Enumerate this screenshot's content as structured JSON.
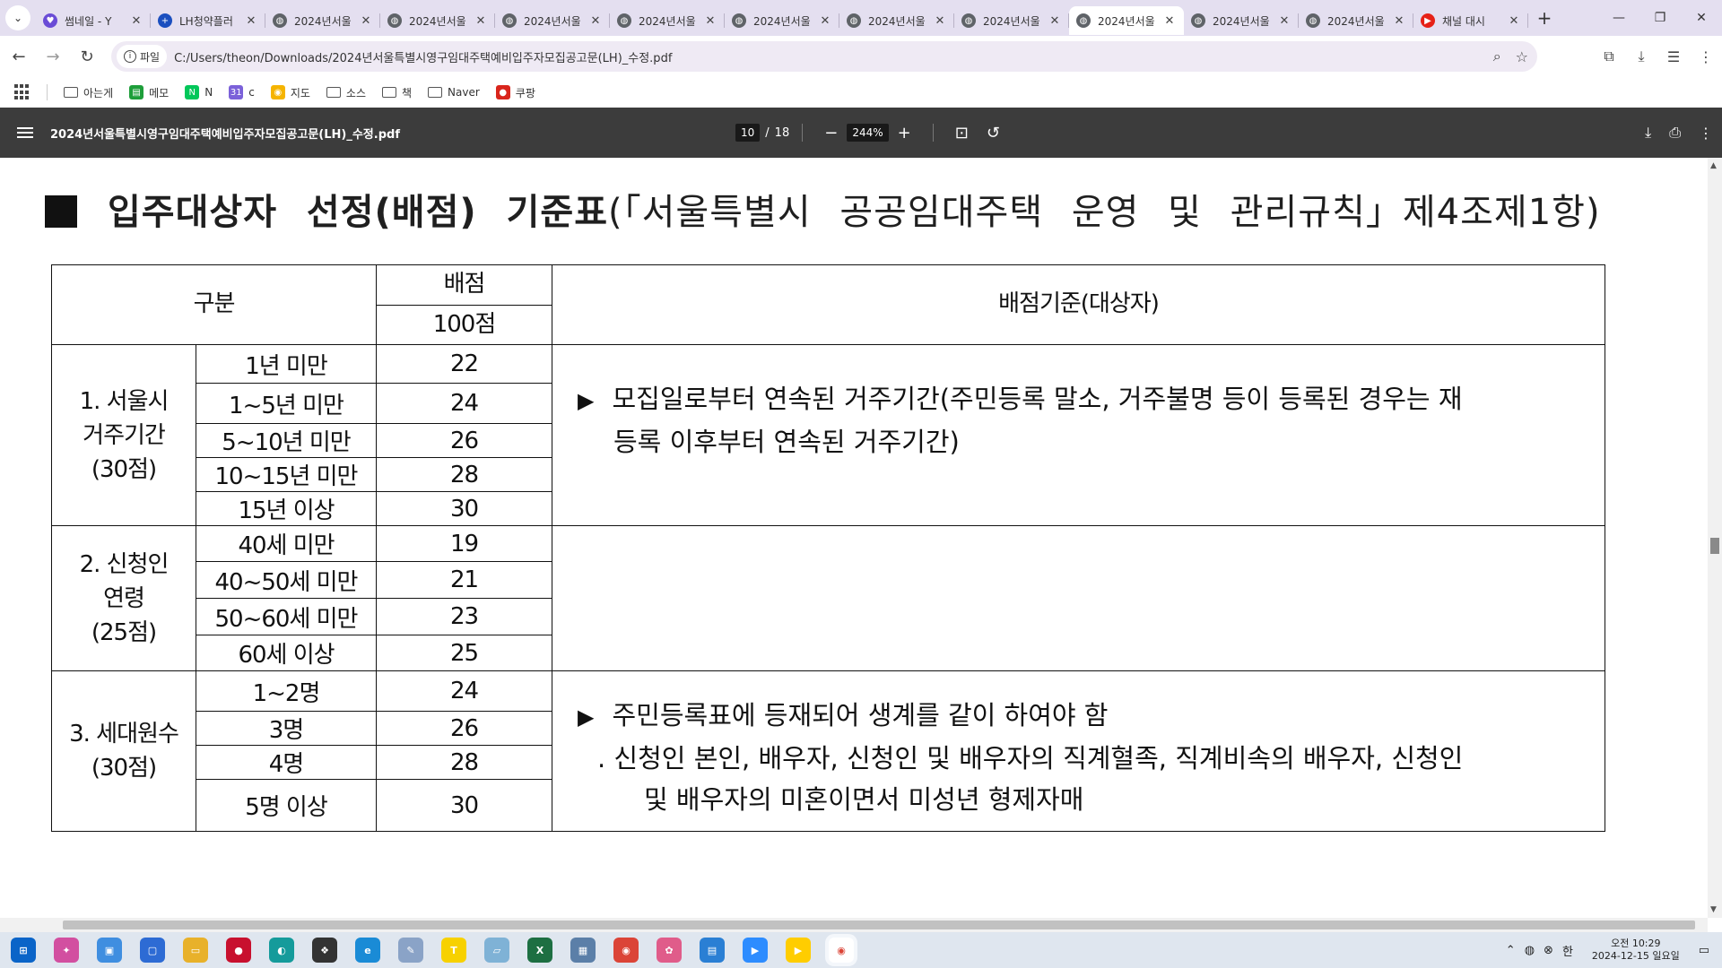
{
  "browser": {
    "tabs": [
      {
        "title": "썸네일 - Y",
        "fav_color": "#6a4cd6",
        "fav_glyph": "♥",
        "icon": "heart-favicon"
      },
      {
        "title": "LH청약플러",
        "fav_color": "#1b4fbf",
        "fav_glyph": "+",
        "icon": "plus-favicon"
      },
      {
        "title": "2024년서울",
        "fav_color": "#5f6368",
        "fav_glyph": "◍",
        "icon": "globe-favicon"
      },
      {
        "title": "2024년서울",
        "fav_color": "#5f6368",
        "fav_glyph": "◍",
        "icon": "globe-favicon"
      },
      {
        "title": "2024년서울",
        "fav_color": "#5f6368",
        "fav_glyph": "◍",
        "icon": "globe-favicon"
      },
      {
        "title": "2024년서울",
        "fav_color": "#5f6368",
        "fav_glyph": "◍",
        "icon": "globe-favicon"
      },
      {
        "title": "2024년서울",
        "fav_color": "#5f6368",
        "fav_glyph": "◍",
        "icon": "globe-favicon"
      },
      {
        "title": "2024년서울",
        "fav_color": "#5f6368",
        "fav_glyph": "◍",
        "icon": "globe-favicon"
      },
      {
        "title": "2024년서울",
        "fav_color": "#5f6368",
        "fav_glyph": "◍",
        "icon": "globe-favicon"
      },
      {
        "title": "2024년서울",
        "fav_color": "#5f6368",
        "fav_glyph": "◍",
        "icon": "globe-favicon",
        "active": true
      },
      {
        "title": "2024년서울",
        "fav_color": "#5f6368",
        "fav_glyph": "◍",
        "icon": "globe-favicon"
      },
      {
        "title": "2024년서울",
        "fav_color": "#5f6368",
        "fav_glyph": "◍",
        "icon": "globe-favicon"
      },
      {
        "title": "채널 대시",
        "fav_color": "#e62117",
        "fav_glyph": "▶",
        "icon": "youtube-favicon"
      }
    ],
    "address": {
      "chip": "파일",
      "url": "C:/Users/theon/Downloads/2024년서울특별시영구임대주택예비입주자모집공고문(LH)_수정.pdf"
    },
    "bookmarks": [
      {
        "label": "아는게",
        "kind": "folder"
      },
      {
        "label": "메모",
        "kind": "icon",
        "color": "#1e9e3a",
        "glyph": "▤"
      },
      {
        "label": "N",
        "kind": "icon",
        "color": "#03c75a",
        "glyph": "N"
      },
      {
        "label": "c",
        "kind": "icon",
        "color": "#7b61d9",
        "glyph": "31"
      },
      {
        "label": "지도",
        "kind": "icon",
        "color": "#f5b400",
        "glyph": "◉"
      },
      {
        "label": "소스",
        "kind": "folder"
      },
      {
        "label": "책",
        "kind": "folder"
      },
      {
        "label": "Naver",
        "kind": "folder"
      },
      {
        "label": "쿠팡",
        "kind": "icon",
        "color": "#d9251c",
        "glyph": "●"
      }
    ]
  },
  "pdf": {
    "title": "2024년서울특별시영구임대주택예비입주자모집공고문(LH)_수정.pdf",
    "page_current": "10",
    "page_separator": "/",
    "page_total": "18",
    "zoom": "244%",
    "heading_bold": "입주대상자 선정(배점) 기준표",
    "heading_rest": "(「서울특별시 공공임대주택 운영 및 관리규칙」제4조제1항)",
    "table": {
      "col_category": "구분",
      "col_score": "배점",
      "col_score_total": "100점",
      "col_criteria": "배점기준(대상자)",
      "groups": [
        {
          "label_lines": [
            "1. 서울시",
            "거주기간",
            "(30점)"
          ],
          "rows": [
            {
              "condition": "1년 미만",
              "score": "22"
            },
            {
              "condition": "1~5년 미만",
              "score": "24"
            },
            {
              "condition": "5~10년 미만",
              "score": "26"
            },
            {
              "condition": "10~15년 미만",
              "score": "28"
            },
            {
              "condition": "15년 이상",
              "score": "30"
            }
          ],
          "criteria": {
            "bullet": "▶",
            "line1": "모집일로부터 연속된 거주기간(주민등록 말소, 거주불명 등이 등록된 경우는 재",
            "line2": "등록 이후부터 연속된 거주기간)"
          }
        },
        {
          "label_lines": [
            "2. 신청인",
            "연령",
            "(25점)"
          ],
          "rows": [
            {
              "condition": "40세 미만",
              "score": "19"
            },
            {
              "condition": "40~50세 미만",
              "score": "21"
            },
            {
              "condition": "50~60세 미만",
              "score": "23"
            },
            {
              "condition": "60세 이상",
              "score": "25"
            }
          ]
        },
        {
          "label_lines": [
            "3. 세대원수",
            "(30점)"
          ],
          "rows": [
            {
              "condition": "1~2명",
              "score": "24"
            },
            {
              "condition": "3명",
              "score": "26"
            },
            {
              "condition": "4명",
              "score": "28"
            },
            {
              "condition": "5명 이상",
              "score": "30"
            }
          ],
          "criteria": {
            "bullet": "▶",
            "line1": "주민등록표에 등재되어 생계를 같이 하여야 함",
            "line2": ". 신청인 본인, 배우자, 신청인 및 배우자의 직계혈족, 직계비속의 배우자, 신청인",
            "line3": "및 배우자의 미혼이면서 미성년 형제자매"
          }
        }
      ]
    }
  },
  "taskbar": {
    "apps": [
      {
        "name": "start",
        "color": "#0a64c8",
        "glyph": "⊞"
      },
      {
        "name": "copilot",
        "color": "#d24fa0",
        "glyph": "✦"
      },
      {
        "name": "files",
        "color": "#3f8ee0",
        "glyph": "▣"
      },
      {
        "name": "app-blue",
        "color": "#2d6bd4",
        "glyph": "▢"
      },
      {
        "name": "explorer",
        "color": "#e8b12a",
        "glyph": "▭"
      },
      {
        "name": "recorder",
        "color": "#c8102e",
        "glyph": "●"
      },
      {
        "name": "teal-app",
        "color": "#159b9b",
        "glyph": "◐"
      },
      {
        "name": "davinci",
        "color": "#333333",
        "glyph": "❖"
      },
      {
        "name": "edge",
        "color": "#1a8bd6",
        "glyph": "e"
      },
      {
        "name": "feather",
        "color": "#8aa3c7",
        "glyph": "✎"
      },
      {
        "name": "kakaotalk",
        "color": "#f7d100",
        "glyph": "T"
      },
      {
        "name": "notes",
        "color": "#7fb2d6",
        "glyph": "▱"
      },
      {
        "name": "excel",
        "color": "#1d6f42",
        "glyph": "X"
      },
      {
        "name": "calculator",
        "color": "#5b7fa8",
        "glyph": "▦"
      },
      {
        "name": "chrome",
        "color": "#db4437",
        "glyph": "◉"
      },
      {
        "name": "paint",
        "color": "#e05c8a",
        "glyph": "✿"
      },
      {
        "name": "store",
        "color": "#2a7fd4",
        "glyph": "▤"
      },
      {
        "name": "zoom",
        "color": "#2d8cff",
        "glyph": "▶"
      },
      {
        "name": "kakao-player",
        "color": "#ffcd00",
        "glyph": "▶"
      },
      {
        "name": "chrome-active",
        "color": "#db4437",
        "glyph": "◉",
        "active": true
      }
    ],
    "tray": {
      "ime": "한",
      "time": "오전 10:29",
      "date": "2024-12-15 일요일"
    }
  }
}
